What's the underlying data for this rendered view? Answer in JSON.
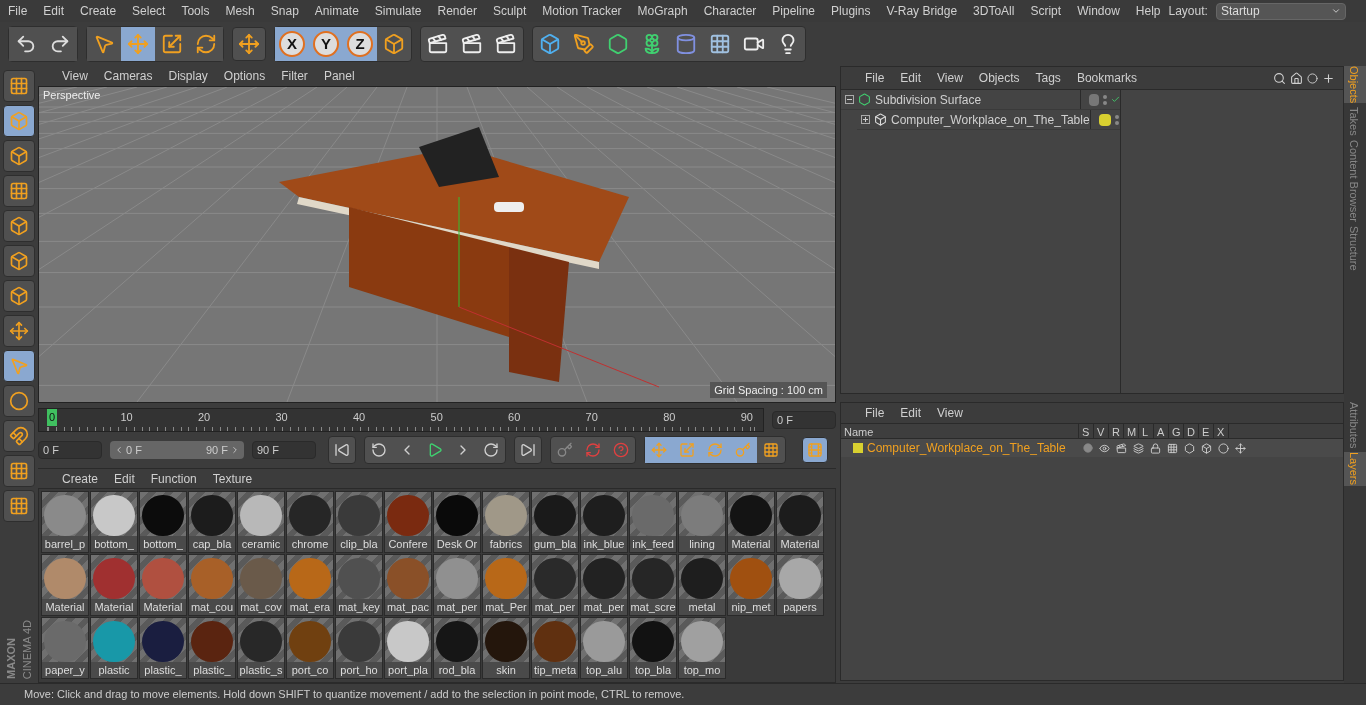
{
  "menu_bar": {
    "items": [
      "File",
      "Edit",
      "Create",
      "Select",
      "Tools",
      "Mesh",
      "Snap",
      "Animate",
      "Simulate",
      "Render",
      "Sculpt",
      "Motion Tracker",
      "MoGraph",
      "Character",
      "Pipeline",
      "Plugins",
      "V-Ray Bridge",
      "3DToAll",
      "Script",
      "Window",
      "Help"
    ],
    "layout_label": "Layout:",
    "layout_value": "Startup"
  },
  "toolbar": {
    "tools": [
      {
        "selected": false
      },
      {
        "selected": false
      },
      {
        "selected": false
      },
      {
        "selected": true
      },
      {
        "selected": false
      },
      {
        "selected": false
      },
      {
        "selected": false
      }
    ],
    "axes": [
      {
        "label": "X",
        "selected": true
      },
      {
        "label": "Y",
        "selected": true
      },
      {
        "label": "Z",
        "selected": true
      }
    ]
  },
  "left_tools": [
    {
      "selected": false
    },
    {
      "selected": true
    },
    {
      "selected": false
    },
    {
      "selected": false
    },
    {
      "selected": false
    },
    {
      "selected": false
    },
    {
      "selected": false
    },
    {
      "selected": false
    },
    {
      "selected": true
    },
    {
      "selected": false
    },
    {
      "selected": false
    },
    {
      "selected": false
    },
    {
      "selected": false
    }
  ],
  "viewport": {
    "menu": [
      "View",
      "Cameras",
      "Display",
      "Options",
      "Filter",
      "Panel"
    ],
    "camera": "Perspective",
    "grid_spacing": "Grid Spacing : 100 cm"
  },
  "timeline": {
    "ticks": [
      {
        "label": "0",
        "selected": true
      },
      {
        "label": "10",
        "selected": false
      },
      {
        "label": "20",
        "selected": false
      },
      {
        "label": "30",
        "selected": false
      },
      {
        "label": "40",
        "selected": false
      },
      {
        "label": "50",
        "selected": false
      },
      {
        "label": "60",
        "selected": false
      },
      {
        "label": "70",
        "selected": false
      },
      {
        "label": "80",
        "selected": false
      },
      {
        "label": "90",
        "selected": false
      }
    ],
    "current_frame": "0 F",
    "start_frame": "0 F",
    "range_start": "0 F",
    "range_end": "90 F",
    "end_frame": "90 F",
    "modes": [
      {
        "selected": true
      },
      {
        "selected": true
      },
      {
        "selected": true
      },
      {
        "selected": true
      },
      {
        "selected": false
      }
    ]
  },
  "material_manager": {
    "menu": [
      "Create",
      "Edit",
      "Function",
      "Texture"
    ],
    "materials": [
      {
        "name": "barrel_p",
        "color": "#8a8a8a"
      },
      {
        "name": "bottom_",
        "color": "#c8c8c8"
      },
      {
        "name": "bottom_",
        "color": "#0c0c0c"
      },
      {
        "name": "cap_bla",
        "color": "#1c1c1c"
      },
      {
        "name": "ceramic",
        "color": "#b8b8b8"
      },
      {
        "name": "chrome",
        "color": "#262626"
      },
      {
        "name": "clip_bla",
        "color": "#3a3a3a"
      },
      {
        "name": "Confere",
        "color": "#7a2a10"
      },
      {
        "name": "Desk Or",
        "color": "#0a0a0a"
      },
      {
        "name": "fabrics",
        "color": "#a09888"
      },
      {
        "name": "gum_bla",
        "color": "#1a1a1a"
      },
      {
        "name": "ink_blue",
        "color": "#1e1e1e"
      },
      {
        "name": "ink_feed",
        "color": "#6a6a6a"
      },
      {
        "name": "lining",
        "color": "#7c7c7c"
      },
      {
        "name": "Material",
        "color": "#141414"
      },
      {
        "name": "Material",
        "color": "#1c1c1c"
      },
      {
        "name": "Material",
        "color": "#b08a6a"
      },
      {
        "name": "Material",
        "color": "#a03030"
      },
      {
        "name": "Material",
        "color": "#b05040"
      },
      {
        "name": "mat_cou",
        "color": "#a86028"
      },
      {
        "name": "mat_cov",
        "color": "#6a5a4a"
      },
      {
        "name": "mat_era",
        "color": "#b86818"
      },
      {
        "name": "mat_key",
        "color": "#505050"
      },
      {
        "name": "mat_pac",
        "color": "#8a5028"
      },
      {
        "name": "mat_per",
        "color": "#909090"
      },
      {
        "name": "mat_Per",
        "color": "#b86818"
      },
      {
        "name": "mat_per",
        "color": "#2a2a2a"
      },
      {
        "name": "mat_per",
        "color": "#222222"
      },
      {
        "name": "mat_scre",
        "color": "#262626"
      },
      {
        "name": "metal",
        "color": "#1e1e1e"
      },
      {
        "name": "nip_met",
        "color": "#a05010"
      },
      {
        "name": "papers",
        "color": "#a8a8a8"
      },
      {
        "name": "paper_y",
        "color": "#6a6a6a"
      },
      {
        "name": "plastic",
        "color": "#1898a8"
      },
      {
        "name": "plastic_",
        "color": "#1a1e40"
      },
      {
        "name": "plastic_",
        "color": "#5a2410"
      },
      {
        "name": "plastic_s",
        "color": "#282828"
      },
      {
        "name": "port_co",
        "color": "#704010"
      },
      {
        "name": "port_ho",
        "color": "#3a3a3a"
      },
      {
        "name": "port_pla",
        "color": "#c8c8c8"
      },
      {
        "name": "rod_bla",
        "color": "#161616"
      },
      {
        "name": "skin",
        "color": "#24160c"
      },
      {
        "name": "tip_meta",
        "color": "#603010"
      },
      {
        "name": "top_alu",
        "color": "#9a9a9a"
      },
      {
        "name": "top_bla",
        "color": "#121212"
      },
      {
        "name": "top_mo",
        "color": "#a0a0a0"
      }
    ]
  },
  "object_manager": {
    "menu": [
      "File",
      "Edit",
      "View",
      "Objects",
      "Tags",
      "Bookmarks"
    ],
    "tree": [
      {
        "name": "Subdivision Surface",
        "expanded": true,
        "enabled": true,
        "children": [
          {
            "name": "Computer_Workplace_on_The_Table",
            "expanded": false,
            "color": "#d8d030"
          }
        ]
      }
    ]
  },
  "side_tabs_top": [
    {
      "label": "Objects",
      "selected": true
    },
    {
      "label": "Takes",
      "selected": false
    },
    {
      "label": "Content Browser",
      "selected": false
    },
    {
      "label": "Structure",
      "selected": false
    }
  ],
  "layer_manager": {
    "menu": [
      "File",
      "Edit",
      "View"
    ],
    "columns": [
      "Name",
      "S",
      "V",
      "R",
      "M",
      "L",
      "A",
      "G",
      "D",
      "E",
      "X"
    ],
    "layers": [
      {
        "name": "Computer_Workplace_on_The_Table",
        "color": "#d8d030"
      }
    ]
  },
  "side_tabs_bottom": [
    {
      "label": "Attributes",
      "selected": false
    },
    {
      "label": "Layers",
      "selected": true
    }
  ],
  "brand": {
    "line1": "MAXON",
    "line2": "CINEMA 4D"
  },
  "status_bar": "Move: Click and drag to move elements. Hold down SHIFT to quantize movement / add to the selection in point mode, CTRL to remove."
}
